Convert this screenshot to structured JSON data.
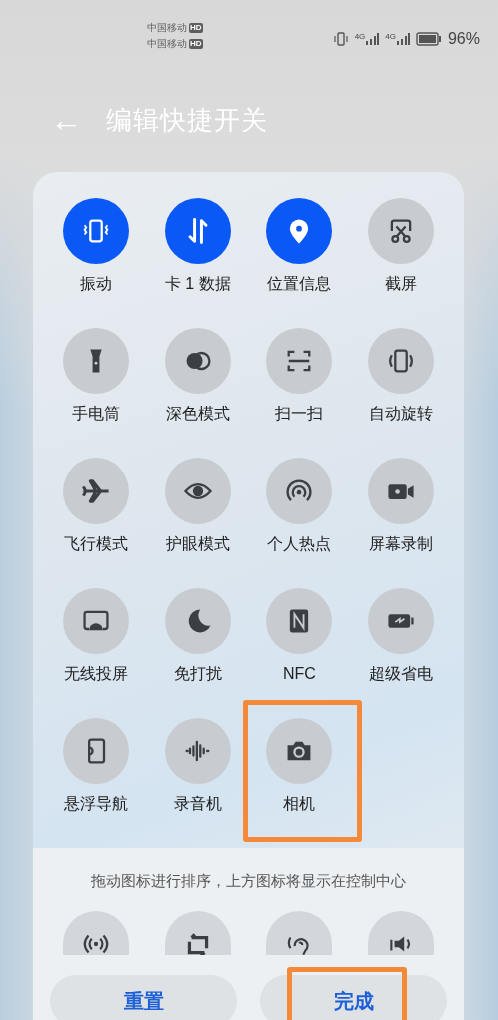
{
  "status_bar": {
    "carriers": [
      {
        "name": "中国移动",
        "badge": "HD"
      },
      {
        "name": "中国移动",
        "badge": "HD"
      }
    ],
    "network_1": "4G",
    "network_2": "4G",
    "battery": "96%"
  },
  "header": {
    "back": "←",
    "title": "编辑快捷开关"
  },
  "tiles": [
    {
      "label": "振动",
      "on": true,
      "highlighted": false
    },
    {
      "label": "卡 1 数据",
      "on": true,
      "highlighted": false
    },
    {
      "label": "位置信息",
      "on": true,
      "highlighted": false
    },
    {
      "label": "截屏",
      "on": false,
      "highlighted": false
    },
    {
      "label": "手电筒",
      "on": false,
      "highlighted": false
    },
    {
      "label": "深色模式",
      "on": false,
      "highlighted": false
    },
    {
      "label": "扫一扫",
      "on": false,
      "highlighted": false
    },
    {
      "label": "自动旋转",
      "on": false,
      "highlighted": false
    },
    {
      "label": "飞行模式",
      "on": false,
      "highlighted": false
    },
    {
      "label": "护眼模式",
      "on": false,
      "highlighted": false
    },
    {
      "label": "个人热点",
      "on": false,
      "highlighted": false
    },
    {
      "label": "屏幕录制",
      "on": false,
      "highlighted": false
    },
    {
      "label": "无线投屏",
      "on": false,
      "highlighted": false
    },
    {
      "label": "免打扰",
      "on": false,
      "highlighted": false
    },
    {
      "label": "NFC",
      "on": false,
      "highlighted": false
    },
    {
      "label": "超级省电",
      "on": false,
      "highlighted": false
    },
    {
      "label": "悬浮导航",
      "on": false,
      "highlighted": false
    },
    {
      "label": "录音机",
      "on": false,
      "highlighted": false
    },
    {
      "label": "相机",
      "on": false,
      "highlighted": true
    }
  ],
  "hint": "拖动图标进行排序，上方图标将显示在控制中心",
  "buttons": [
    {
      "label": "重置",
      "highlighted": false
    },
    {
      "label": "完成",
      "highlighted": true
    }
  ]
}
